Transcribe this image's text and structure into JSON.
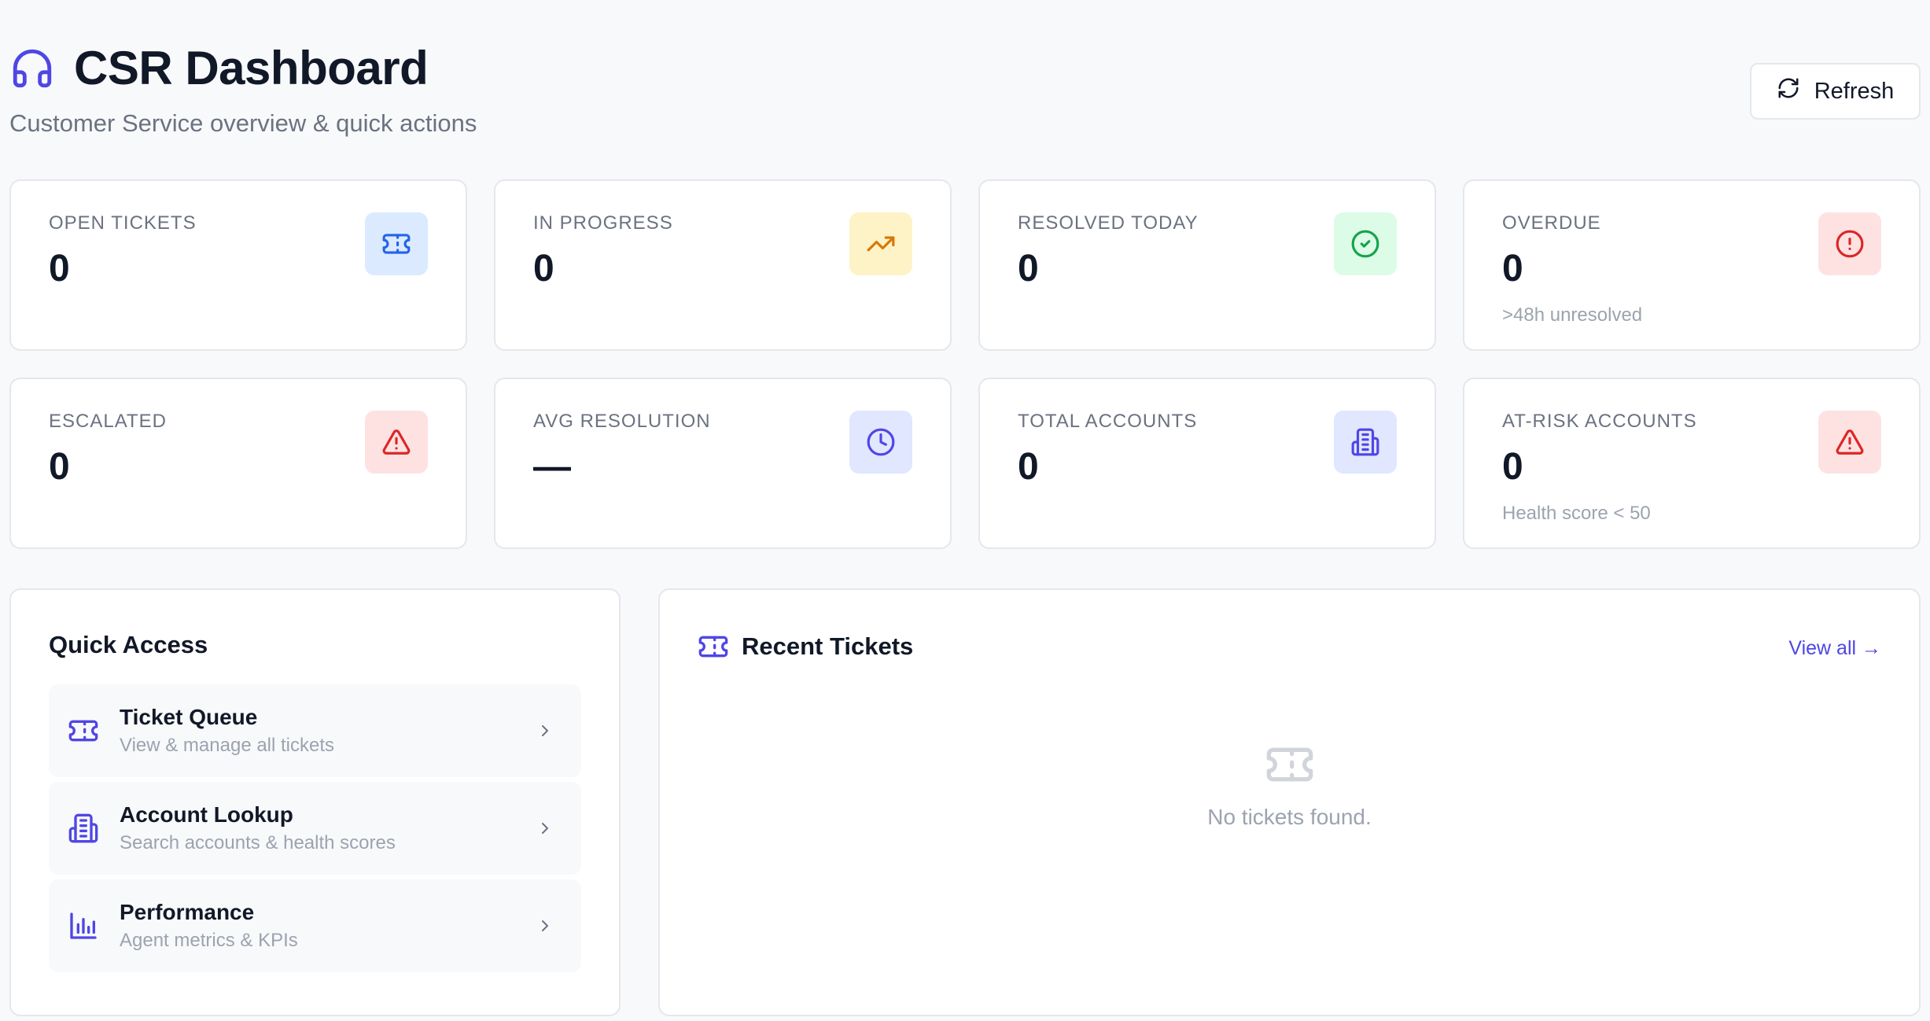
{
  "header": {
    "title": "CSR Dashboard",
    "subtitle": "Customer Service overview & quick actions",
    "title_icon": "headphones-icon",
    "refresh_label": "Refresh"
  },
  "colors": {
    "accent": "#4f46e5",
    "blue_bg": "#dbeafe",
    "blue_fg": "#2563eb",
    "amber_bg": "#fef3c7",
    "amber_fg": "#d97706",
    "green_bg": "#dcfce7",
    "green_fg": "#16a34a",
    "red_bg": "#fee2e2",
    "red_fg": "#dc2626",
    "indigo_bg": "#e0e7ff",
    "indigo_fg": "#4f46e5"
  },
  "stats": [
    {
      "label": "OPEN TICKETS",
      "value": "0",
      "note": "",
      "icon": "ticket-icon"
    },
    {
      "label": "IN PROGRESS",
      "value": "0",
      "note": "",
      "icon": "trending-up-icon"
    },
    {
      "label": "RESOLVED TODAY",
      "value": "0",
      "note": "",
      "icon": "check-circle-icon"
    },
    {
      "label": "OVERDUE",
      "value": "0",
      "note": ">48h unresolved",
      "icon": "alert-circle-icon"
    },
    {
      "label": "ESCALATED",
      "value": "0",
      "note": "",
      "icon": "alert-triangle-icon"
    },
    {
      "label": "AVG RESOLUTION",
      "value": "—",
      "note": "",
      "icon": "clock-icon"
    },
    {
      "label": "TOTAL ACCOUNTS",
      "value": "0",
      "note": "",
      "icon": "building-icon"
    },
    {
      "label": "AT-RISK ACCOUNTS",
      "value": "0",
      "note": "Health score < 50",
      "icon": "alert-triangle-icon"
    }
  ],
  "quick_access": {
    "title": "Quick Access",
    "items": [
      {
        "title": "Ticket Queue",
        "desc": "View & manage all tickets",
        "icon": "ticket-icon"
      },
      {
        "title": "Account Lookup",
        "desc": "Search accounts & health scores",
        "icon": "building-icon"
      },
      {
        "title": "Performance",
        "desc": "Agent metrics & KPIs",
        "icon": "bar-chart-icon"
      }
    ]
  },
  "recent_tickets": {
    "title": "Recent Tickets",
    "view_all": "View all →",
    "empty_text": "No tickets found.",
    "icon": "ticket-icon"
  }
}
